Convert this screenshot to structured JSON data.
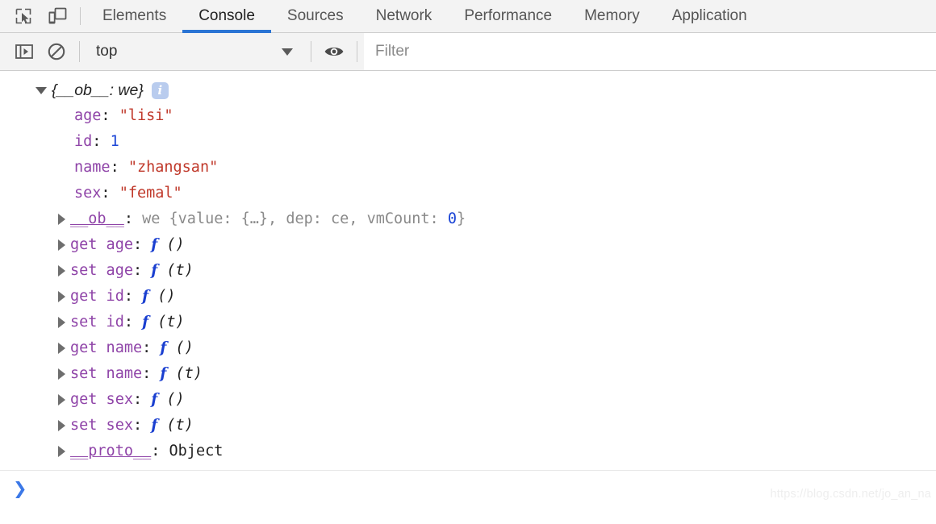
{
  "tabstrip": {
    "inspect_icon": "inspect-cursor-icon",
    "device_icon": "device-toolbar-icon",
    "tabs": [
      {
        "label": "Elements",
        "active": false
      },
      {
        "label": "Console",
        "active": true
      },
      {
        "label": "Sources",
        "active": false
      },
      {
        "label": "Network",
        "active": false
      },
      {
        "label": "Performance",
        "active": false
      },
      {
        "label": "Memory",
        "active": false
      },
      {
        "label": "Application",
        "active": false
      }
    ]
  },
  "console_toolbar": {
    "sidebar_icon": "console-sidebar-icon",
    "clear_icon": "clear-console-icon",
    "context": "top",
    "eye_icon": "live-expression-eye-icon",
    "filter_placeholder": "Filter"
  },
  "console_output": {
    "header": {
      "text": "{__ob__: we}",
      "badge": "i"
    },
    "properties": [
      {
        "name": "age",
        "punct": ": ",
        "value": "\"lisi\"",
        "value_type": "string"
      },
      {
        "name": "id",
        "punct": ": ",
        "value": "1",
        "value_type": "number"
      },
      {
        "name": "name",
        "punct": ": ",
        "value": "\"zhangsan\"",
        "value_type": "string"
      },
      {
        "name": "sex",
        "punct": ": ",
        "value": "\"femal\"",
        "value_type": "string"
      }
    ],
    "ob_line": {
      "name": "__ob__",
      "punct": ": ",
      "ctor": "we ",
      "preview_a": "{value: {…}, dep: ce, vmCount: ",
      "preview_num": "0",
      "preview_b": "}"
    },
    "accessors": [
      {
        "name": "get age",
        "punct": ": ",
        "fn": "f",
        "args": "()"
      },
      {
        "name": "set age",
        "punct": ": ",
        "fn": "f",
        "args": "(t)"
      },
      {
        "name": "get id",
        "punct": ": ",
        "fn": "f",
        "args": "()"
      },
      {
        "name": "set id",
        "punct": ": ",
        "fn": "f",
        "args": "(t)"
      },
      {
        "name": "get name",
        "punct": ": ",
        "fn": "f",
        "args": "()"
      },
      {
        "name": "set name",
        "punct": ": ",
        "fn": "f",
        "args": "(t)"
      },
      {
        "name": "get sex",
        "punct": ": ",
        "fn": "f",
        "args": "()"
      },
      {
        "name": "set sex",
        "punct": ": ",
        "fn": "f",
        "args": "(t)"
      }
    ],
    "proto_line": {
      "name": "__proto__",
      "punct": ": ",
      "value": "Object"
    }
  },
  "prompt": {
    "chevron": "❯"
  },
  "watermark": {
    "text": "https://blog.csdn.net/jo_an_na"
  },
  "colors": {
    "accent": "#2a74d4",
    "property": "#8f44a8",
    "string": "#c0392b",
    "number": "#1a44d6",
    "function": "#1a3fd0",
    "gray": "#8a8a8a",
    "toolbar_bg": "#f3f3f3"
  }
}
